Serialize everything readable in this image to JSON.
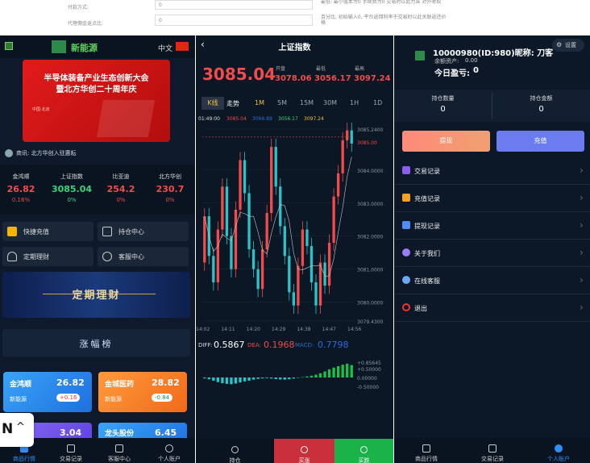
{
  "top_strip": {
    "row1_label": "付款方式:",
    "row2_label": "代理佣金返点比:",
    "field1": "0",
    "field2": "0",
    "hint1": "最低: 最小值本为0 手续费为0 交易时以此为准 对外收取",
    "hint2": "百分比, 初始输入0, 平台返佣利率于交易时以此关联返还价格",
    "hint3": "订单 以下单价格为准 用作 无需计算出"
  },
  "home": {
    "brand": "新能源",
    "lang": "中文",
    "banner_title1": "半导体装备产业生态创新大会",
    "banner_title2": "暨北方华创二十周年庆",
    "banner_sub": "中国·北京",
    "notice": "商讯: 北方华创入驻惠耘",
    "quotes": [
      {
        "name": "金鸿顺",
        "price": "26.82",
        "change": "0.16%"
      },
      {
        "name": "上证指数",
        "price": "3085.04",
        "change": "0%"
      },
      {
        "name": "比亚迪",
        "price": "254.2",
        "change": "0%"
      },
      {
        "name": "北方华创",
        "price": "230.7",
        "change": "0%"
      }
    ],
    "menu": [
      "快捷充值",
      "持仓中心",
      "定期理财",
      "客服中心"
    ],
    "promo": "定期理财",
    "ranking_title": "涨幅榜",
    "cards": [
      {
        "name": "金鸿顺",
        "price": "26.82",
        "tag": "新能源",
        "delta": "+0.16"
      },
      {
        "name": "金城医药",
        "price": "28.82",
        "tag": "新能源",
        "delta": "-0.84"
      },
      {
        "name": "",
        "price": "3.04",
        "tag": "",
        "delta": ""
      },
      {
        "name": "龙头股份",
        "price": "6.45",
        "tag": "",
        "delta": ""
      }
    ],
    "nav": [
      "商品行情",
      "交易记录",
      "客服中心",
      "个人账户"
    ],
    "n_badge": "N"
  },
  "chart": {
    "title": "上证指数",
    "price": "3085.04",
    "open_label": "开盘",
    "low_label": "最低",
    "high_label": "最高",
    "open": "3078.06",
    "low": "3056.17",
    "high": "3097.24",
    "tabs": [
      "K线",
      "走势",
      "1M",
      "5M",
      "15M",
      "30M",
      "1H",
      "1D"
    ],
    "time": "01:49:00",
    "ma_values": [
      "3085.04",
      "3066.88",
      "3056.17",
      "3097.24"
    ],
    "y_ticks": [
      "3085.2400",
      "3084.0000",
      "3083.0000",
      "3082.0000",
      "3081.0000",
      "3080.0000",
      "3079.4300"
    ],
    "last_label": "3085.00",
    "x_ticks": [
      "14:02",
      "14:11",
      "14:20",
      "14:29",
      "14:38",
      "14:47",
      "14:56"
    ],
    "diff_label": "DIFF:",
    "diff": "0.5867",
    "dea_label": "DEA:",
    "dea": "0.1968",
    "macd_label": "MACD:",
    "macd": "0.7798",
    "macd_ticks": [
      "+0.85645",
      "+0.50000",
      "0.00000",
      "-0.50000"
    ],
    "bottom": [
      "持仓",
      "买涨",
      "买跌"
    ],
    "candles": [
      [
        3081.2,
        3082.6
      ],
      [
        3082.6,
        3081.4
      ],
      [
        3081.4,
        3080.6
      ],
      [
        3080.6,
        3082.2
      ],
      [
        3082.2,
        3083.5
      ],
      [
        3083.5,
        3082.0
      ],
      [
        3082.0,
        3081.0
      ],
      [
        3081.0,
        3082.8
      ],
      [
        3082.8,
        3084.3
      ],
      [
        3084.3,
        3083.3
      ],
      [
        3083.3,
        3081.6
      ],
      [
        3081.6,
        3081.0
      ],
      [
        3081.0,
        3080.4
      ],
      [
        3080.4,
        3081.6
      ],
      [
        3081.6,
        3082.7
      ],
      [
        3082.7,
        3084.7
      ],
      [
        3084.7,
        3083.5
      ],
      [
        3083.5,
        3082.3
      ],
      [
        3082.3,
        3081.4
      ],
      [
        3081.4,
        3080.3
      ],
      [
        3080.3,
        3079.9
      ],
      [
        3079.9,
        3081.1
      ],
      [
        3081.1,
        3082.2
      ],
      [
        3082.2,
        3081.7
      ],
      [
        3081.7,
        3080.6
      ],
      [
        3080.6,
        3079.9
      ],
      [
        3079.9,
        3081.2
      ],
      [
        3081.2,
        3080.5
      ],
      [
        3080.5,
        3081.8
      ],
      [
        3081.8,
        3083.2
      ],
      [
        3083.2,
        3083.9
      ],
      [
        3083.9,
        3084.9
      ],
      [
        3084.9,
        3085.2
      ],
      [
        3085.2,
        3084.8
      ]
    ],
    "macd_bars": [
      -0.05,
      -0.1,
      -0.18,
      -0.26,
      -0.32,
      -0.36,
      -0.38,
      -0.34,
      -0.28,
      -0.22,
      -0.18,
      -0.12,
      -0.08,
      -0.05,
      -0.04,
      -0.06,
      -0.09,
      -0.11,
      -0.12,
      -0.1,
      -0.06,
      -0.02,
      0.02,
      0.06,
      0.1,
      0.16,
      0.24,
      0.34,
      0.46,
      0.56,
      0.64,
      0.72,
      0.78,
      0.7
    ]
  },
  "account": {
    "name": "10000980(ID:980)昵称: 刀客",
    "balance_label": "余额资产:",
    "balance": "0.00",
    "pnl_label": "今日盈亏:",
    "pnl": "0",
    "settings": "设置",
    "pos_qty_label": "持仓数量",
    "pos_qty": "0",
    "pos_amt_label": "持仓金额",
    "pos_amt": "0",
    "withdraw": "提现",
    "recharge": "充值",
    "menu": [
      "交易记录",
      "充值记录",
      "提现记录",
      "关于我们",
      "在线客服",
      "退出"
    ],
    "nav": [
      "商品行情",
      "交易记录",
      "个人账户"
    ]
  }
}
